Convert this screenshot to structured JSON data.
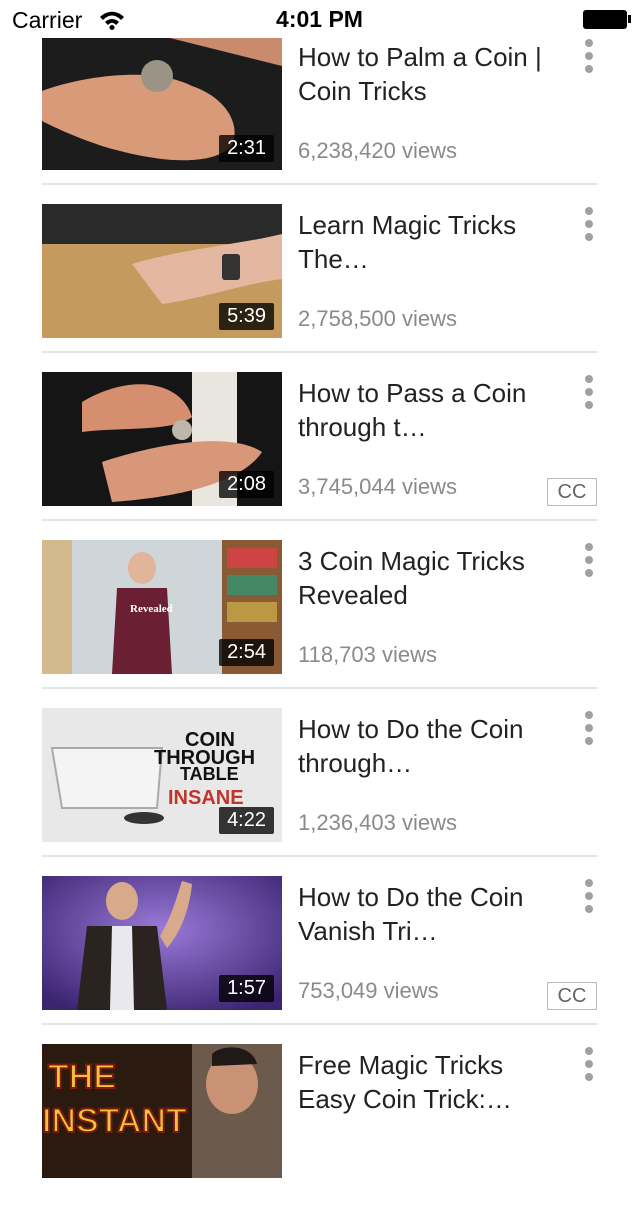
{
  "status_bar": {
    "carrier": "Carrier",
    "time": "4:01 PM"
  },
  "videos": [
    {
      "title": "How to Palm a Coin | Coin Tricks",
      "duration": "2:31",
      "views": "6,238,420 views",
      "cc": "",
      "thumb_icon": "hand-coin-thumbnail"
    },
    {
      "title": "Learn Magic Tricks The…",
      "duration": "5:39",
      "views": "2,758,500 views",
      "cc": "",
      "thumb_icon": "table-hands-thumbnail"
    },
    {
      "title": "How to Pass a Coin through t…",
      "duration": "2:08",
      "views": "3,745,044 views",
      "cc": "CC",
      "thumb_icon": "coin-pass-thumbnail"
    },
    {
      "title": "3 Coin Magic Tricks Revealed",
      "duration": "2:54",
      "views": "118,703 views",
      "cc": "",
      "thumb_icon": "revealed-thumbnail",
      "thumb_text": "Revealed"
    },
    {
      "title": "How to Do the Coin through…",
      "duration": "4:22",
      "views": "1,236,403 views",
      "cc": "",
      "thumb_icon": "coin-through-table-thumbnail",
      "thumb_text_lines": [
        "COIN",
        "THROUGH",
        "TABLE",
        "INSANE"
      ]
    },
    {
      "title": "How to Do the Coin Vanish Tri…",
      "duration": "1:57",
      "views": "753,049 views",
      "cc": "CC",
      "thumb_icon": "magician-thumbnail"
    },
    {
      "title": "Free Magic Tricks Easy Coin Trick:…",
      "duration": "",
      "views": "",
      "cc": "",
      "thumb_icon": "instant-thumbnail",
      "thumb_text_lines": [
        "THE",
        "INSTANT"
      ]
    }
  ]
}
